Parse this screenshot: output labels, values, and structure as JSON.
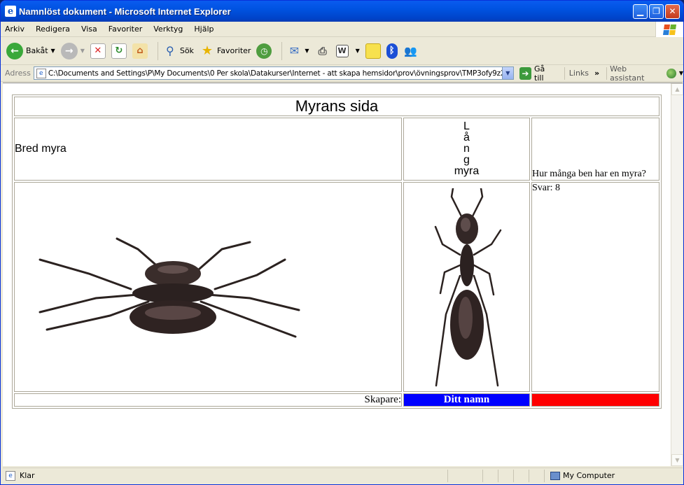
{
  "window": {
    "title": "Namnlöst dokument - Microsoft Internet Explorer"
  },
  "menu": [
    "Arkiv",
    "Redigera",
    "Visa",
    "Favoriter",
    "Verktyg",
    "Hjälp"
  ],
  "toolbar": {
    "back_label": "Bakåt",
    "search_label": "Sök",
    "favorites_label": "Favoriter"
  },
  "address": {
    "label": "Adress",
    "url": "C:\\Documents and Settings\\P\\My Documents\\0 Per skola\\Datakurser\\Internet - att skapa hemsidor\\prov\\övningsprov\\TMP3ofy9z2gvc.",
    "go_label": "Gå till",
    "links_label": "Links",
    "web_assistant_label": "Web assistant"
  },
  "page": {
    "heading": "Myrans sida",
    "bred_label": "Bred myra",
    "lang_letters": [
      "L",
      "å",
      "n",
      "g"
    ],
    "lang_word": "myra",
    "question": "Hur många ben har en myra?",
    "answer": "Svar: 8",
    "creator_label": "Skapare:",
    "name_cell": "Ditt namn"
  },
  "status": {
    "left": "Klar",
    "zone": "My Computer"
  },
  "colors": {
    "name_cell_bg": "#0000ff",
    "empty_cell_bg": "#ff0000",
    "titlebar": "#0053e1"
  }
}
